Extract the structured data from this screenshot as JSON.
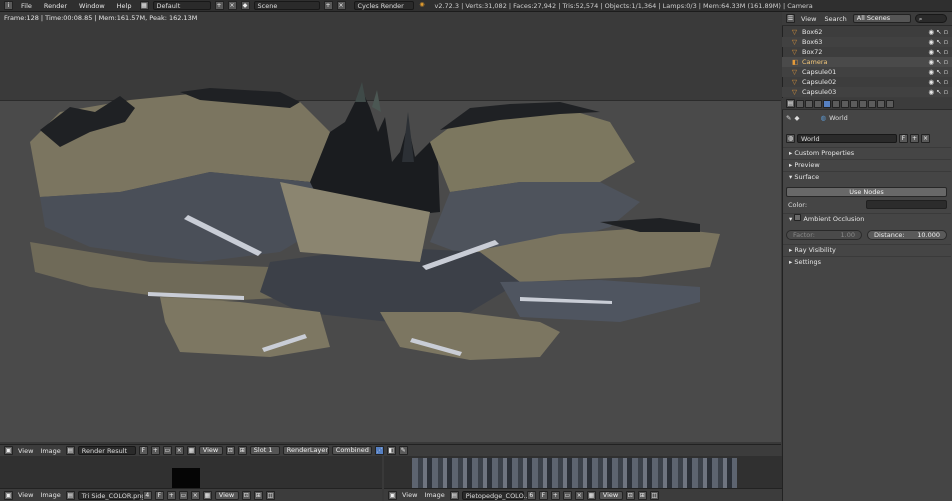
{
  "topbar": {
    "menus": [
      "File",
      "Render",
      "Window",
      "Help"
    ],
    "screen_layout": "Default",
    "scene": "Scene",
    "render_engine": "Cycles Render",
    "stats": "v2.72.3 | Verts:31,082 | Faces:27,942 | Tris:52,574 | Objects:1/1,364 | Lamps:0/3 | Mem:64.33M (161.89M) | Camera"
  },
  "viewport": {
    "frame_info": "Frame:128 | Time:00:08.85 | Mem:161.57M, Peak: 162.13M"
  },
  "image_editor_top": {
    "menus": [
      "View",
      "Image"
    ],
    "image": "Render Result",
    "fake_user": "F",
    "view": "View",
    "slot": "Slot 1",
    "layer": "RenderLayer",
    "pass": "Combined"
  },
  "image_editor_left": {
    "menus": [
      "View",
      "Image"
    ],
    "image": "Tri Side_COLOR.png",
    "users": "4",
    "fake_user": "F",
    "view": "View"
  },
  "image_editor_right": {
    "menus": [
      "View",
      "Image"
    ],
    "image": "Pietopedge_COLO...",
    "users": "6",
    "fake_user": "F",
    "view": "View"
  },
  "outliner": {
    "menus": [
      "View",
      "Search"
    ],
    "scene_filter": "All Scenes",
    "items": [
      {
        "label": "Box62"
      },
      {
        "label": "Box63"
      },
      {
        "label": "Box72"
      },
      {
        "label": "Camera"
      },
      {
        "label": "Capsule01"
      },
      {
        "label": "Capsule02"
      },
      {
        "label": "Capsule03"
      }
    ]
  },
  "properties": {
    "context": "World",
    "world_name": "World",
    "fake_user": "F",
    "panels": {
      "custom_properties": "Custom Properties",
      "preview": "Preview",
      "surface": "Surface",
      "use_nodes": "Use Nodes",
      "color_label": "Color:",
      "ambient_occlusion": "Ambient Occlusion",
      "factor_label": "Factor:",
      "factor_value": "1.00",
      "distance_label": "Distance:",
      "distance_value": "10.000",
      "ray_visibility": "Ray Visibility",
      "settings": "Settings"
    }
  },
  "colors": {
    "accent": "#5680c2",
    "viewport_bg": "#3a3a3a",
    "frame_bg": "#4a4a4a",
    "panel_bg": "#454545"
  }
}
